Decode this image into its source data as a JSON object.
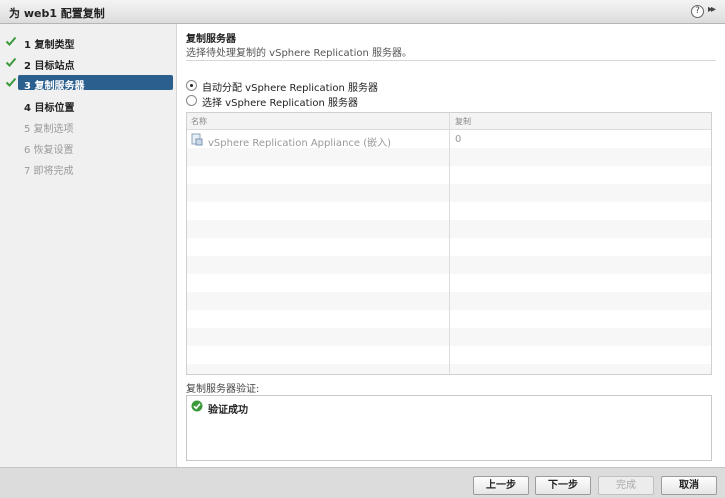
{
  "window": {
    "title": "为 web1 配置复制",
    "help": "?",
    "collapse": "▸▸"
  },
  "steps": [
    {
      "label": "1 复制类型",
      "state": "completed"
    },
    {
      "label": "2 目标站点",
      "state": "completed"
    },
    {
      "label": "3 复制服务器",
      "state": "active"
    },
    {
      "label": "4 目标位置",
      "state": "enabled"
    },
    {
      "label": "5 复制选项",
      "state": "disabled"
    },
    {
      "label": "6 恢复设置",
      "state": "disabled"
    },
    {
      "label": "7 即将完成",
      "state": "disabled"
    }
  ],
  "main": {
    "title": "复制服务器",
    "description": "选择待处理复制的 vSphere Replication 服务器。",
    "options": [
      {
        "label": "自动分配 vSphere Replication 服务器",
        "checked": true
      },
      {
        "label": "选择 vSphere Replication 服务器",
        "checked": false
      }
    ],
    "table": {
      "columns": [
        "名称",
        "复制"
      ],
      "rows": [
        {
          "name": "vSphere Replication Appliance (嵌入)",
          "count": "0"
        }
      ]
    },
    "validation": {
      "label": "复制服务器验证:",
      "result": "验证成功",
      "status_color": "#3c9a3c"
    }
  },
  "footer": {
    "back": "上一步",
    "next": "下一步",
    "finish": "完成",
    "cancel": "取消"
  },
  "colors": {
    "accent": "#2b5f8e",
    "check": "#3c9a3c"
  }
}
